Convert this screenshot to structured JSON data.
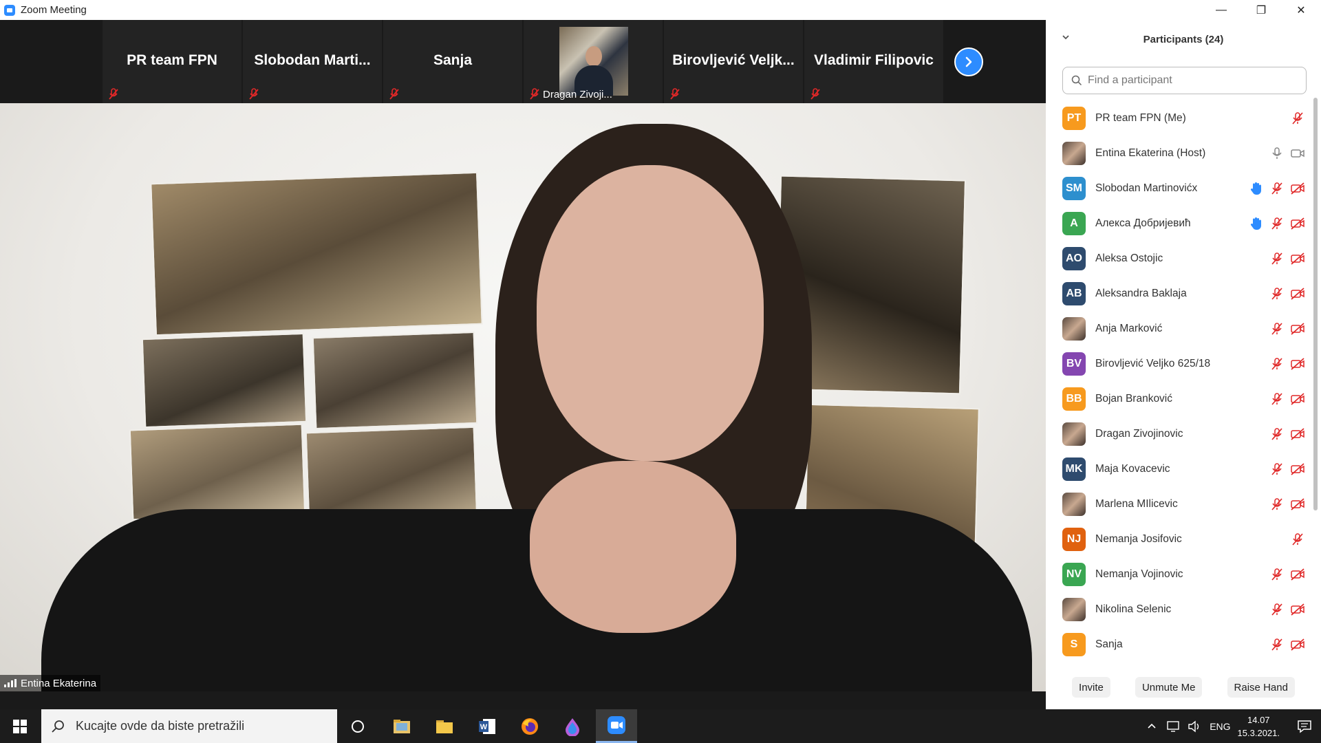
{
  "window": {
    "title": "Zoom Meeting",
    "controls": [
      "—",
      "❐",
      "✕"
    ]
  },
  "strip": {
    "tiles": [
      {
        "name": "PR team FPN",
        "muted": true
      },
      {
        "name": "Slobodan  Marti...",
        "muted": true
      },
      {
        "name": "Sanja",
        "muted": true
      },
      {
        "name": "Dragan Zivoji...",
        "muted": true,
        "video": true
      },
      {
        "name": "Birovljević  Veljk...",
        "muted": true
      },
      {
        "name": "Vladimir Filipovic",
        "muted": true
      }
    ]
  },
  "main_video": {
    "speaker": "Entina Ekaterina"
  },
  "panel": {
    "title": "Participants (24)",
    "search_placeholder": "Find a participant",
    "participants": [
      {
        "initials": "PT",
        "name": "PR team FPN (Me)",
        "color": "#f79a1e",
        "icons": [
          "mic-muted-icon"
        ]
      },
      {
        "initials": "",
        "name": "Entina Ekaterina (Host)",
        "color": "photo",
        "icons": [
          "mic-icon",
          "video-icon"
        ]
      },
      {
        "initials": "SM",
        "name": "Slobodan Martinovićx",
        "color": "#2d8fce",
        "icons": [
          "raised-hand-icon",
          "mic-muted-icon",
          "video-off-icon"
        ]
      },
      {
        "initials": "A",
        "name": "Алекса Добријевић",
        "color": "#3aa652",
        "icons": [
          "raised-hand-icon",
          "mic-muted-icon",
          "video-off-icon"
        ]
      },
      {
        "initials": "AO",
        "name": "Aleksa Ostojic",
        "color": "#2e4b6e",
        "icons": [
          "mic-muted-icon",
          "video-off-icon"
        ]
      },
      {
        "initials": "AB",
        "name": "Aleksandra Baklaja",
        "color": "#2e4b6e",
        "icons": [
          "mic-muted-icon",
          "video-off-icon"
        ]
      },
      {
        "initials": "",
        "name": "Anja Marković",
        "color": "photo",
        "icons": [
          "mic-muted-icon",
          "video-off-icon"
        ]
      },
      {
        "initials": "BV",
        "name": "Birovljević Veljko 625/18",
        "color": "#8446b0",
        "icons": [
          "mic-muted-icon",
          "video-off-icon"
        ]
      },
      {
        "initials": "BB",
        "name": "Bojan Branković",
        "color": "#f79a1e",
        "icons": [
          "mic-muted-icon",
          "video-off-icon"
        ]
      },
      {
        "initials": "",
        "name": "Dragan Zivojinovic",
        "color": "photo",
        "icons": [
          "mic-muted-icon",
          "video-off-icon"
        ]
      },
      {
        "initials": "MK",
        "name": "Maja Kovacevic",
        "color": "#2e4b6e",
        "icons": [
          "mic-muted-icon",
          "video-off-icon"
        ]
      },
      {
        "initials": "",
        "name": "Marlena MIlicevic",
        "color": "photo",
        "icons": [
          "mic-muted-icon",
          "video-off-icon"
        ]
      },
      {
        "initials": "NJ",
        "name": "Nemanja Josifovic",
        "color": "#e0610f",
        "icons": [
          "mic-muted-icon"
        ]
      },
      {
        "initials": "NV",
        "name": "Nemanja Vojinovic",
        "color": "#3aa652",
        "icons": [
          "mic-muted-icon",
          "video-off-icon"
        ]
      },
      {
        "initials": "",
        "name": "Nikolina Selenic",
        "color": "photo",
        "icons": [
          "mic-muted-icon",
          "video-off-icon"
        ]
      },
      {
        "initials": "S",
        "name": "Sanja",
        "color": "#f79a1e",
        "icons": [
          "mic-muted-icon",
          "video-off-icon"
        ]
      }
    ],
    "buttons": {
      "invite": "Invite",
      "unmute": "Unmute Me",
      "raise_hand": "Raise Hand"
    }
  },
  "taskbar": {
    "search_placeholder": "Kucajte ovde da biste pretražili",
    "language": "ENG",
    "time": "14.07",
    "date": "15.3.2021."
  }
}
